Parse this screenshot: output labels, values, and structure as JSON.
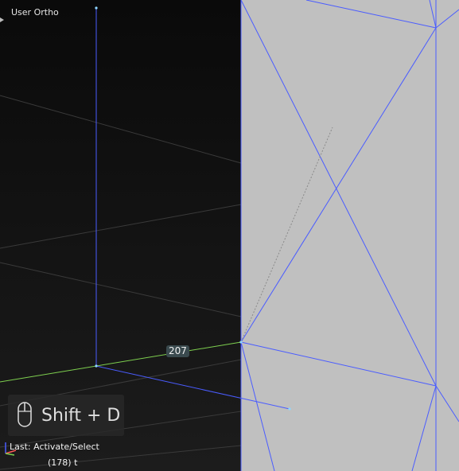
{
  "viewport": {
    "view_name": "User Ortho",
    "measure_value": "207",
    "shortcut": {
      "icon": "mouse-icon",
      "text": "Shift + D"
    },
    "last_operation": "Last: Activate/Select",
    "frame_info": "(178) t"
  },
  "colors": {
    "background_dark": "#0a0a0a",
    "object_face": "#c0c0c0",
    "edge_blue": "#4a5cff",
    "axis_green": "#7ed04f",
    "grid": "#3a3a3a"
  }
}
